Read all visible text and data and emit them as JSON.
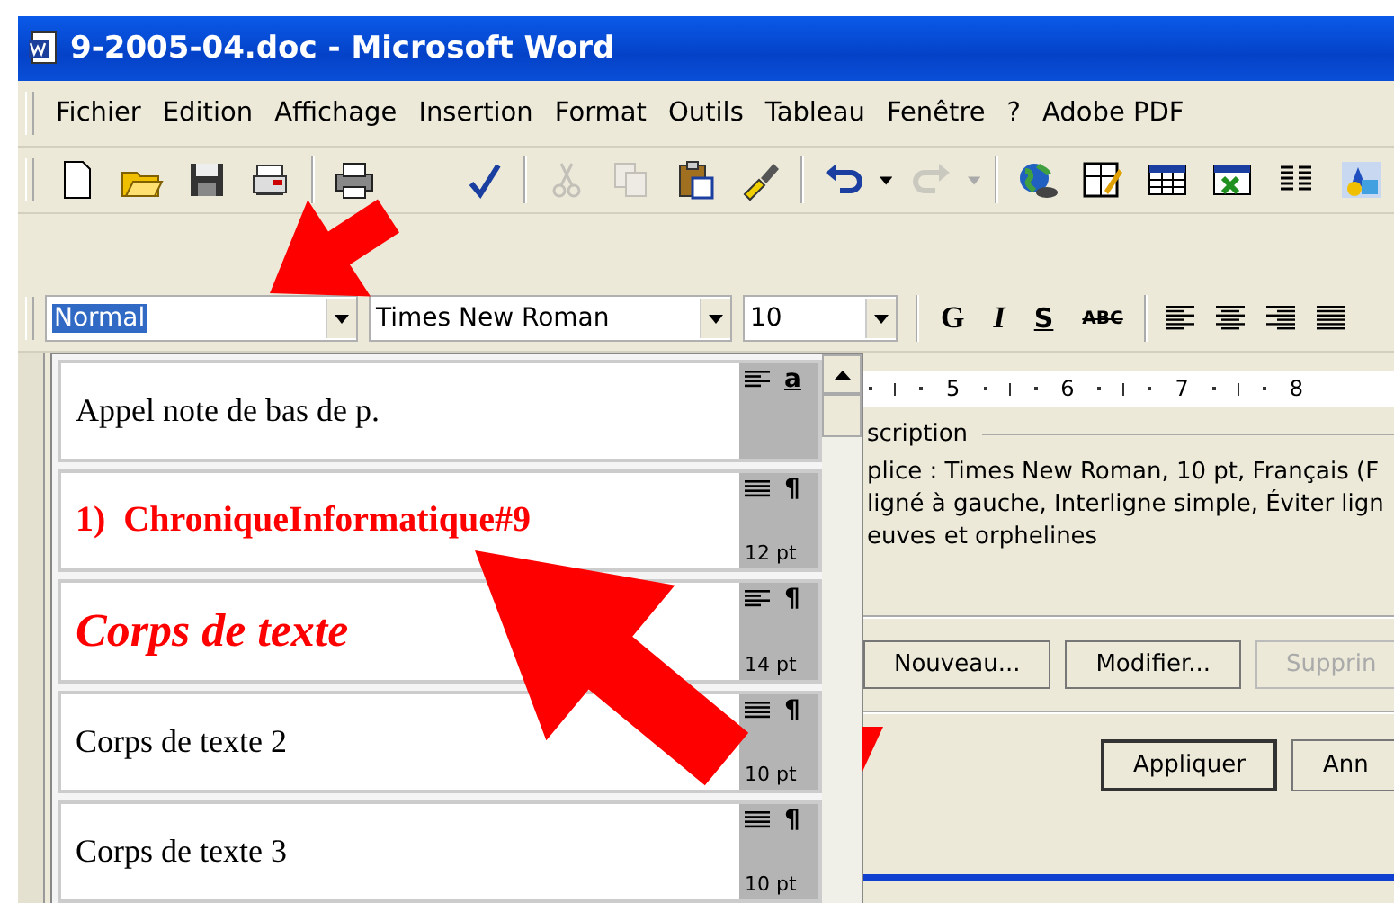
{
  "window": {
    "title": "9-2005-04.doc - Microsoft Word"
  },
  "menu": [
    {
      "label": "Fichier"
    },
    {
      "label": "Edition"
    },
    {
      "label": "Affichage"
    },
    {
      "label": "Insertion"
    },
    {
      "label": "Format"
    },
    {
      "label": "Outils"
    },
    {
      "label": "Tableau"
    },
    {
      "label": "Fenêtre"
    },
    {
      "label": "?"
    },
    {
      "label": "Adobe PDF"
    }
  ],
  "toolbar": [
    {
      "kind": "new",
      "disabled": false
    },
    {
      "kind": "open",
      "disabled": false
    },
    {
      "kind": "save",
      "disabled": false
    },
    {
      "kind": "permission",
      "disabled": false
    },
    {
      "kind": "sep"
    },
    {
      "kind": "print",
      "disabled": false
    },
    {
      "kind": "gap"
    },
    {
      "kind": "spell",
      "disabled": false
    },
    {
      "kind": "sep"
    },
    {
      "kind": "cut",
      "disabled": true
    },
    {
      "kind": "copy",
      "disabled": true
    },
    {
      "kind": "paste",
      "disabled": false
    },
    {
      "kind": "brush",
      "disabled": false
    },
    {
      "kind": "sep"
    },
    {
      "kind": "undo",
      "disabled": false
    },
    {
      "kind": "redo",
      "disabled": true
    },
    {
      "kind": "sep"
    },
    {
      "kind": "globe",
      "disabled": false
    },
    {
      "kind": "drawtable",
      "disabled": false
    },
    {
      "kind": "table",
      "disabled": false
    },
    {
      "kind": "sheet",
      "disabled": false
    },
    {
      "kind": "columns",
      "disabled": false
    },
    {
      "kind": "drawing",
      "disabled": false
    }
  ],
  "formatting": {
    "style": "Normal",
    "font": "Times New Roman",
    "size": "10",
    "buttons": [
      {
        "label": "G",
        "kind": "bold"
      },
      {
        "label": "I",
        "kind": "italic"
      },
      {
        "label": "S",
        "kind": "underline"
      },
      {
        "label": "ABC",
        "kind": "strike"
      }
    ],
    "alignments": [
      {
        "kind": "left"
      },
      {
        "kind": "center"
      },
      {
        "kind": "right"
      },
      {
        "kind": "justify"
      }
    ]
  },
  "style_list": [
    {
      "name": "Appel note de bas de p.",
      "kind": "plain",
      "justified": false,
      "mark": "a"
    },
    {
      "name": "1)  ChroniqueInformatique#9",
      "kind": "heading",
      "color": "#ff0000",
      "justified": true,
      "mark": "¶",
      "size": "12 pt"
    },
    {
      "name": "Corps de texte",
      "kind": "emphasis",
      "color": "#ff0000",
      "justified": false,
      "mark": "¶",
      "size": "14 pt"
    },
    {
      "name": "Corps de texte 2",
      "kind": "plain",
      "justified": true,
      "mark": "¶",
      "size": "10 pt"
    },
    {
      "name": "Corps de texte 3",
      "kind": "plain",
      "justified": true,
      "mark": "¶",
      "size": "10 pt"
    }
  ],
  "ruler": [
    "5",
    "6",
    "7",
    "8"
  ],
  "description": {
    "heading": "scription",
    "lines": [
      "plice : Times New Roman, 10 pt, Français (F",
      "ligné à gauche, Interligne simple, Éviter lign",
      "euves et orphelines"
    ]
  },
  "actions": [
    {
      "label": "Nouveau...",
      "disabled": false
    },
    {
      "label": "Modifier...",
      "disabled": false
    },
    {
      "label": "Supprin",
      "disabled": true
    }
  ],
  "dialog_buttons": [
    {
      "label": "Appliquer",
      "default": true
    },
    {
      "label": "Ann",
      "default": false
    }
  ]
}
